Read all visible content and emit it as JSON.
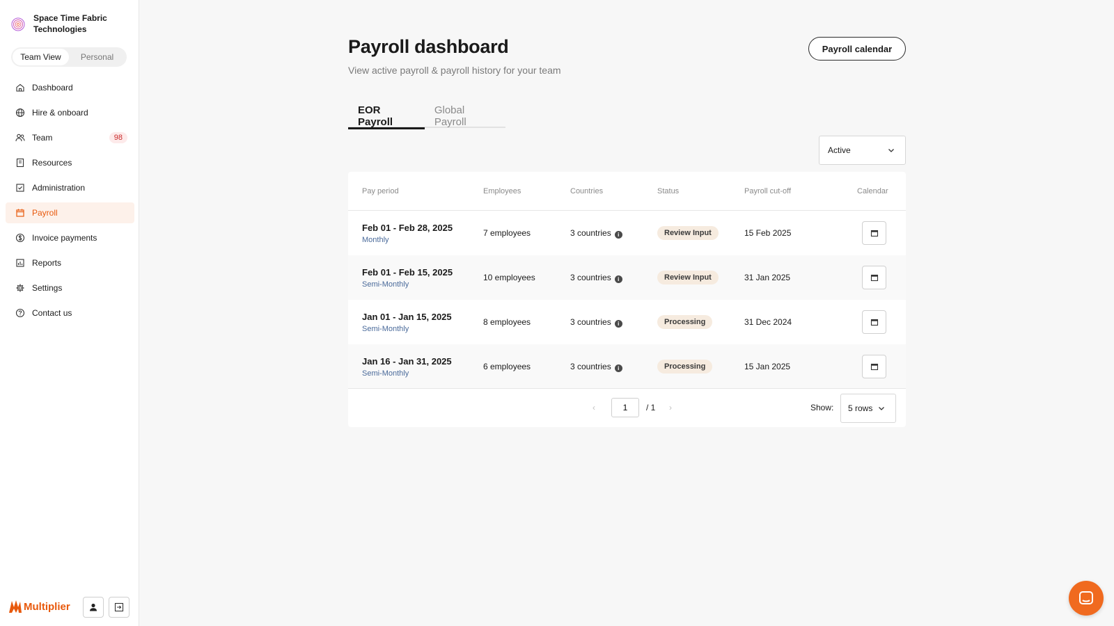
{
  "org": {
    "name": "Space Time Fabric Technologies"
  },
  "view_toggle": {
    "team": "Team View",
    "personal": "Personal",
    "active": "team"
  },
  "nav": [
    {
      "label": "Dashboard",
      "icon": "home-icon"
    },
    {
      "label": "Hire & onboard",
      "icon": "globe-icon"
    },
    {
      "label": "Team",
      "icon": "people-icon",
      "badge": "98"
    },
    {
      "label": "Resources",
      "icon": "book-icon"
    },
    {
      "label": "Administration",
      "icon": "checklist-icon"
    },
    {
      "label": "Payroll",
      "icon": "calendar-icon",
      "active": true
    },
    {
      "label": "Invoice payments",
      "icon": "dollar-icon"
    },
    {
      "label": "Reports",
      "icon": "chart-icon"
    },
    {
      "label": "Settings",
      "icon": "gear-icon"
    },
    {
      "label": "Contact us",
      "icon": "help-icon"
    }
  ],
  "brand": {
    "name": "Multiplier",
    "color": "#e8590c"
  },
  "page": {
    "title": "Payroll dashboard",
    "subtitle": "View active payroll & payroll history for your team",
    "calendar_button": "Payroll calendar"
  },
  "tabs": [
    {
      "label": "EOR Payroll",
      "active": true
    },
    {
      "label": "Global Payroll",
      "active": false
    }
  ],
  "filter": {
    "selected": "Active"
  },
  "table": {
    "headers": [
      "Pay period",
      "Employees",
      "Countries",
      "Status",
      "Payroll cut-off",
      "Calendar"
    ],
    "rows": [
      {
        "period": "Feb 01 - Feb 28, 2025",
        "frequency": "Monthly",
        "employees": "7 employees",
        "countries": "3 countries",
        "status": "Review Input",
        "cutoff": "15 Feb 2025"
      },
      {
        "period": "Feb 01 - Feb 15, 2025",
        "frequency": "Semi-Monthly",
        "employees": "10 employees",
        "countries": "3 countries",
        "status": "Review Input",
        "cutoff": "31 Jan 2025"
      },
      {
        "period": "Jan 01 - Jan 15, 2025",
        "frequency": "Semi-Monthly",
        "employees": "8 employees",
        "countries": "3 countries",
        "status": "Processing",
        "cutoff": "31 Dec 2024"
      },
      {
        "period": "Jan 16 - Jan 31, 2025",
        "frequency": "Semi-Monthly",
        "employees": "6 employees",
        "countries": "3 countries",
        "status": "Processing",
        "cutoff": "15 Jan 2025"
      }
    ]
  },
  "pagination": {
    "current": "1",
    "total": "/ 1",
    "show_label": "Show:",
    "rows_option": "5 rows"
  },
  "colors": {
    "accent": "#e8590c",
    "status_bg": "#f6ebdf",
    "badge_text": "#c92a2a",
    "chat_button": "#f06a1f"
  }
}
